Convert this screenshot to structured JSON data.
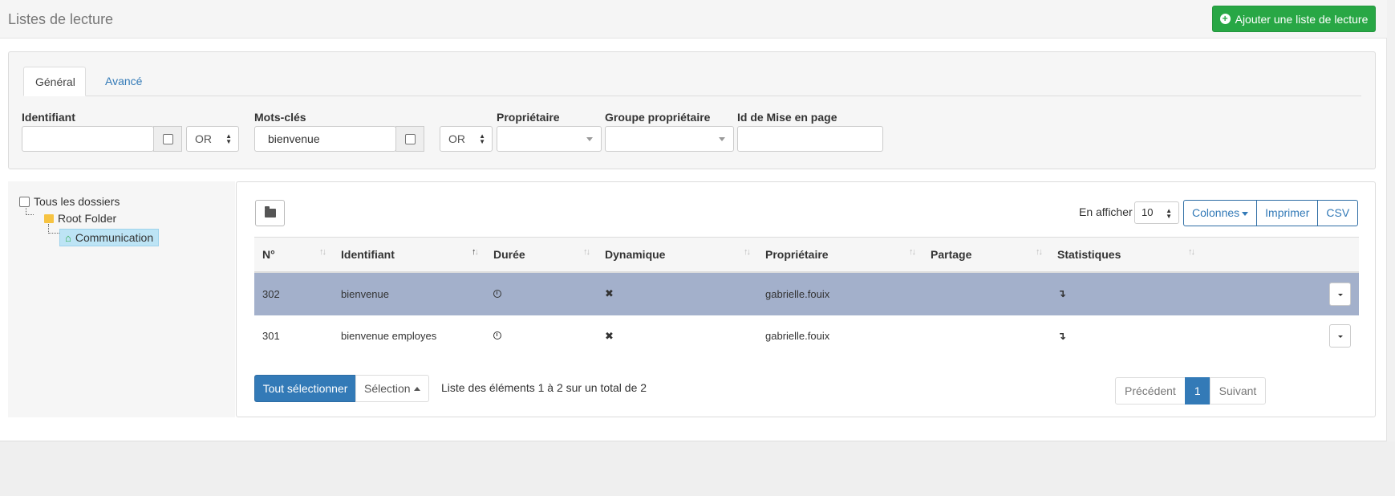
{
  "header": {
    "title": "Listes de lecture",
    "add_button": "Ajouter une liste de lecture"
  },
  "filters": {
    "tabs": [
      "Général",
      "Avancé"
    ],
    "identifiant": {
      "label": "Identifiant",
      "value": "",
      "operator": "OR"
    },
    "mots_cles": {
      "label": "Mots-clés",
      "value": "bienvenue",
      "operator": "OR"
    },
    "proprietaire": {
      "label": "Propriétaire",
      "value": ""
    },
    "groupe_proprietaire": {
      "label": "Groupe propriétaire",
      "value": ""
    },
    "id_mise_en_page": {
      "label": "Id de Mise en page",
      "value": ""
    }
  },
  "tree": {
    "all_folders": "Tous les dossiers",
    "root": "Root Folder",
    "selected": "Communication"
  },
  "toolbar": {
    "show_label": "En afficher",
    "page_size": "10",
    "columns_button": "Colonnes",
    "print_button": "Imprimer",
    "csv_button": "CSV"
  },
  "table": {
    "columns": [
      "N°",
      "Identifiant",
      "Durée",
      "Dynamique",
      "Propriétaire",
      "Partage",
      "Statistiques"
    ],
    "rows": [
      {
        "num": "302",
        "identifiant": "bienvenue",
        "duree_icon": "clock-icon",
        "dynamique_icon": "times-icon",
        "proprietaire": "gabrielle.fouix",
        "partage": "",
        "stats_icon": "arrow-down-icon",
        "selected": true
      },
      {
        "num": "301",
        "identifiant": "bienvenue employes",
        "duree_icon": "clock-icon",
        "dynamique_icon": "times-icon",
        "proprietaire": "gabrielle.fouix",
        "partage": "",
        "stats_icon": "arrow-down-icon",
        "selected": false
      }
    ]
  },
  "footer": {
    "select_all": "Tout sélectionner",
    "selection": "Sélection",
    "info": "Liste des éléments 1 à 2 sur un total de 2",
    "prev": "Précédent",
    "page": "1",
    "next": "Suivant"
  },
  "colors": {
    "primary": "#337ab7",
    "success": "#28a745",
    "selected_row": "#a3b0cb",
    "tree_selected": "#bde4f5"
  }
}
